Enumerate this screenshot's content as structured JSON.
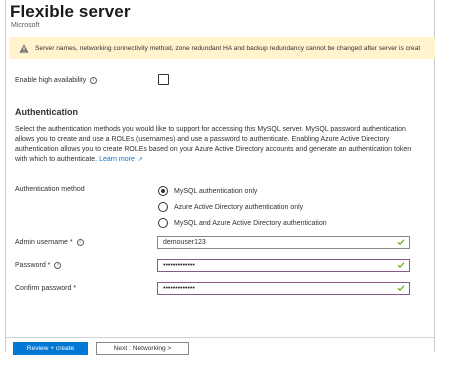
{
  "header": {
    "title": "Flexible server",
    "subtitle": "Microsoft",
    "more_label": "···"
  },
  "warning": {
    "icon": "warning-icon",
    "text": "Server names, networking connectivity method, zone redundant HA and backup redundancy cannot be changed after server is creat"
  },
  "high_availability": {
    "label": "Enable high availability",
    "info_icon": "i",
    "checked": false
  },
  "authentication": {
    "section_title": "Authentication",
    "description_1": "Select the authentication methods you would like to support for accessing this MySQL server. MySQL password authentication allows you to create and use a ROLEs (usernames) and use a password to authenticate. Enabling Azure Active Directory authentication allows you to create ROLEs based on your Azure Active Directory accounts and generate an authentication token with which to authenticate.",
    "learn_more": "Learn more",
    "method_label": "Authentication method",
    "options": [
      {
        "label": "MySQL authentication only",
        "selected": true
      },
      {
        "label": "Azure Active Directory authentication only",
        "selected": false
      },
      {
        "label": "MySQL and Azure Active Directory authentication",
        "selected": false
      }
    ]
  },
  "fields": {
    "admin_username": {
      "label": "Admin username *",
      "value": "demouser123",
      "info_icon": "i"
    },
    "password": {
      "label": "Password *",
      "value": "•••••••••••••",
      "info_icon": "i"
    },
    "confirm_password": {
      "label": "Confirm password *",
      "value": "•••••••••••••"
    }
  },
  "footer": {
    "primary_label": "Review + create",
    "secondary_label": "Next : Networking >"
  },
  "colors": {
    "accent": "#0078d4",
    "warning_bg": "#fff4ce",
    "valid_check": "#57a300"
  }
}
